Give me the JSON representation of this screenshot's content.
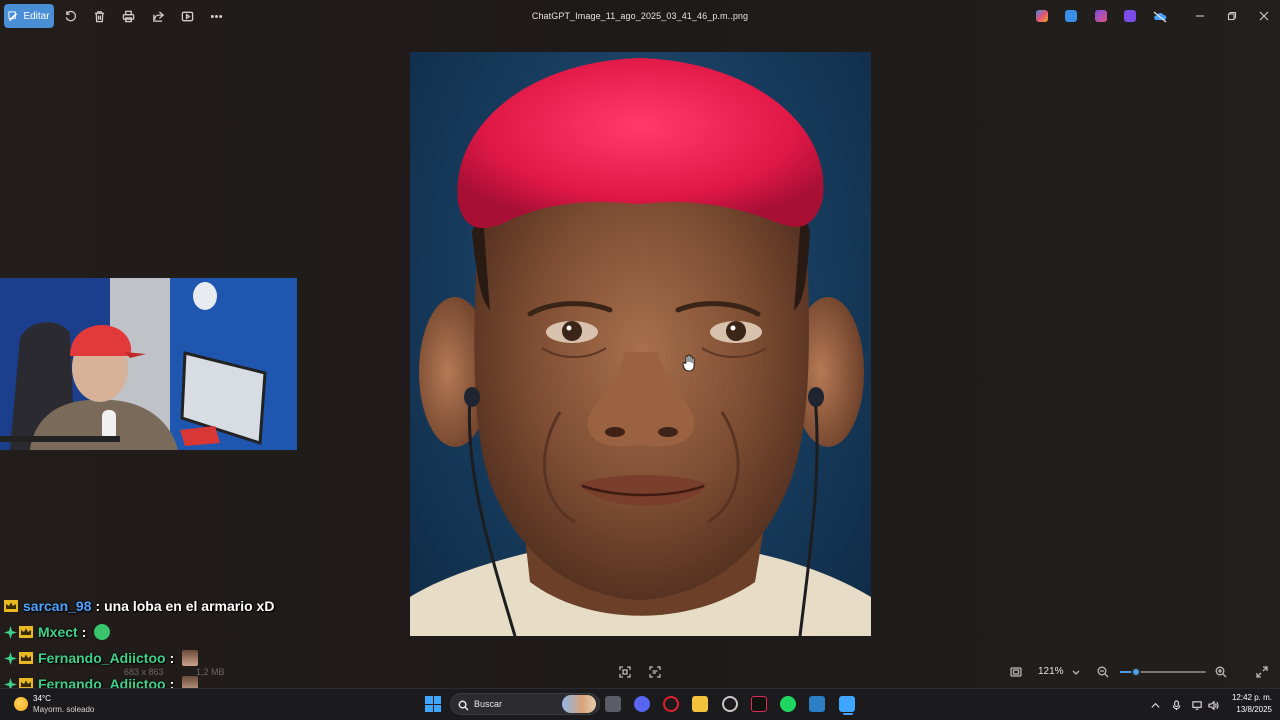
{
  "titlebar": {
    "edit_label": "Editar",
    "filename": "ChatGPT_Image_11_ago_2025_03_41_46_p.m..png",
    "tool_icons": [
      "rotate-icon",
      "delete-icon",
      "print-icon",
      "share-icon",
      "slideshow-icon",
      "more-icon"
    ],
    "tray_apps": [
      {
        "name": "copilot-app-icon",
        "color": "#e0527a"
      },
      {
        "name": "paint-app-icon",
        "color": "#3b8ee8"
      },
      {
        "name": "clipchamp-app-icon",
        "color": "#c44bd8"
      },
      {
        "name": "designer-app-icon",
        "color": "#7b4ee8"
      },
      {
        "name": "onedrive-app-icon",
        "color": "#4aa3ff"
      }
    ]
  },
  "chat": {
    "messages": [
      {
        "user": "sarcan_98",
        "text": ": una loba en el armario xD",
        "color": "blue",
        "plus": false
      },
      {
        "user": "Mxect",
        "text": ":",
        "color": "green",
        "plus": true,
        "emote": "green"
      },
      {
        "user": "Fernando_Adiictoo",
        "text": ":",
        "color": "green",
        "plus": true,
        "emote": "face"
      },
      {
        "user": "Fernando_Adiictoo",
        "text": ":",
        "color": "green",
        "plus": true,
        "emote": "face"
      }
    ]
  },
  "bottom": {
    "dimensions": "683 x 863",
    "size": "1,2 MB",
    "zoom": "121%",
    "zoom_fraction": 0.19
  },
  "taskbar": {
    "temperature": "34°C",
    "weather": "Mayorm. soleado",
    "search_label": "Buscar",
    "time": "12:42 p. m.",
    "date": "13/8/2025"
  },
  "colors": {
    "accent": "#4a8fd6",
    "chat_blue": "#4aa3ff",
    "chat_green": "#3fd18a",
    "crown": "#e8b923"
  }
}
